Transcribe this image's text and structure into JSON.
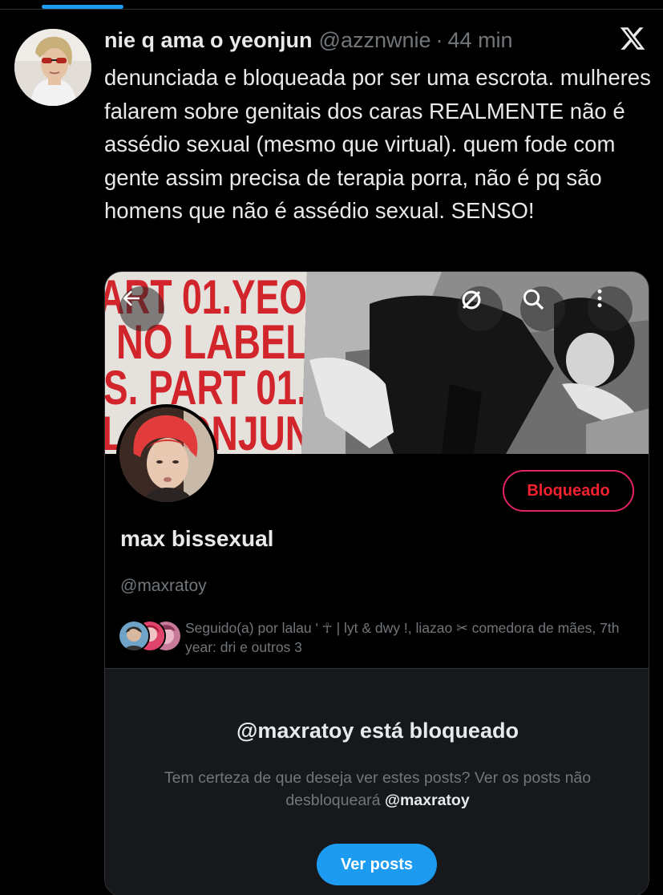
{
  "tweet": {
    "author_name": "nie q ama o yeonjun",
    "author_handle": "@azznwnie",
    "separator": "·",
    "time": "44 min",
    "text": "denunciada e bloqueada por ser uma escrota. mulheres falarem sobre genitais dos caras REALMENTE não é assédio sexual (mesmo que virtual). quem fode com gente assim precisa de terapia porra, não é pq são homens que não é assédio sexual. SENSO!"
  },
  "card": {
    "banner_text_lines": [
      "ART 01.YEO",
      "NO LABEL",
      "S. PART 01.",
      "L YEONJUN"
    ],
    "banner_icons": [
      "back-arrow-icon",
      "no-photo-icon",
      "search-icon",
      "more-vertical-icon"
    ],
    "blocked_button_label": "Bloqueado",
    "profile_name": "max bissexual",
    "profile_handle": "@maxratoy",
    "followers_text_prefix": "Seguido(a) por lalau ' ",
    "followers_glyph_dagger": "☥",
    "followers_text_mid": " | lyt & dwy !, liazao ",
    "followers_glyph_scissors": "✂",
    "followers_text_suffix": " comedora de mães, 7th year: dri e outros 3",
    "blocked_title": "@maxratoy está bloqueado",
    "blocked_desc_prefix": "Tem certeza de que deseja ver estes posts? Ver os posts não desbloqueará ",
    "blocked_desc_handle": "@maxratoy",
    "view_posts_label": "Ver posts"
  },
  "colors": {
    "accent": "#1d9bf0",
    "danger": "#f4212e",
    "text_primary": "#e7e9ea",
    "text_secondary": "#71767b",
    "background": "#000000",
    "panel": "#16181c"
  }
}
